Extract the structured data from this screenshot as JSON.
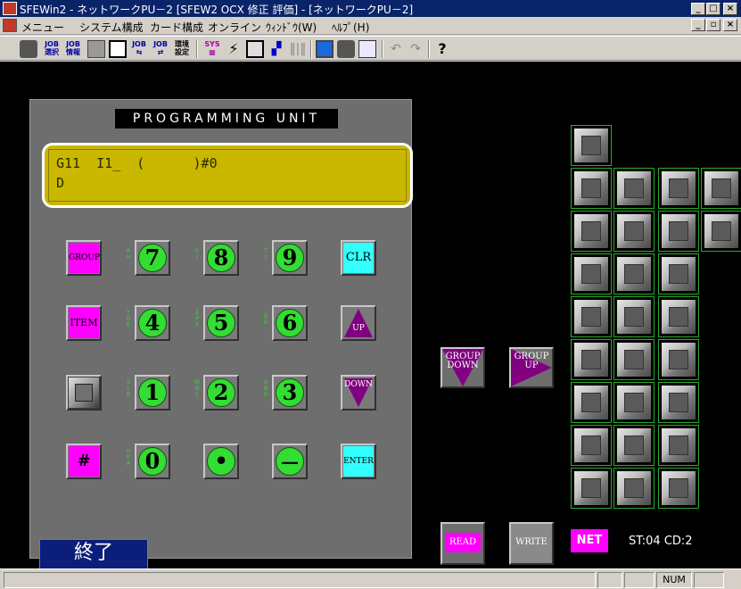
{
  "window": {
    "title": "SFEWin2 - ネットワークPU－2 [SFEW2 OCX 修正 評価] - [ネットワークPU－2]",
    "buttons": [
      "_",
      "□",
      "×"
    ]
  },
  "menubar": {
    "items": [
      "メニュー",
      "システム構成",
      "カード構成",
      "オンライン",
      "ｳｨﾝﾄﾞｳ(W)",
      "ﾍﾙﾌﾟ(H)"
    ]
  },
  "toolbar": {
    "icons": [
      "stop-icon",
      "job-select-icon",
      "job-info-icon",
      "calc-icon",
      "document-icon",
      "job-a-icon",
      "job-b-icon",
      "env-settings-icon",
      "sys-icon",
      "lightning-icon",
      "card-icon",
      "network-icon",
      "bars-icon",
      "monitor-icon",
      "chip-icon",
      "grid-icon",
      "undo-icon",
      "redo-icon",
      "help-icon"
    ],
    "labels": {
      "job_select": "JOB\n選択",
      "job_info": "JOB\n情報",
      "job_a": "JOB",
      "job_b": "JOB",
      "env": "環境\n設定",
      "sys": "SYS",
      "help": "?"
    }
  },
  "pu": {
    "title": "PROGRAMMING  UNIT",
    "lcd_line1": "G11  I1_  (      )#0",
    "lcd_line2": "D",
    "keys": {
      "group": "GROUP",
      "item": "ITEM",
      "hash": "#",
      "n7": "7",
      "n8": "8",
      "n9": "9",
      "n4": "4",
      "n5": "5",
      "n6": "6",
      "n1": "1",
      "n2": "2",
      "n3": "3",
      "n0": "0",
      "dot": "•",
      "minus": "—",
      "clr": "CLR",
      "up": "UP",
      "down": "DOWN",
      "enter": "ENTER"
    },
    "side_labels": {
      "s7": "R\nH",
      "s8": "S\nI",
      "s9": "T\nJ",
      "s4": "Y\nO\nE",
      "s5": "Z\nP\nF",
      "s6": "Q\nG",
      "s1": "V\nL\nB",
      "s2": "W\nM\nC",
      "s3": "X\nN\nD",
      "s0": "U\nK\nA"
    },
    "exit_label": "終了"
  },
  "controls": {
    "group_down": "GROUP\nDOWN",
    "group_up": "GROUP\nUP",
    "read": "READ",
    "write": "WRITE",
    "net": "NET",
    "station": "ST:04 CD:2"
  },
  "colors": {
    "magenta": "#ff00ff",
    "cyan": "#33ffff",
    "green": "#33dd33",
    "purple": "#800080",
    "lcd": "#c9b700"
  },
  "statusbar": {
    "num": "NUM"
  }
}
